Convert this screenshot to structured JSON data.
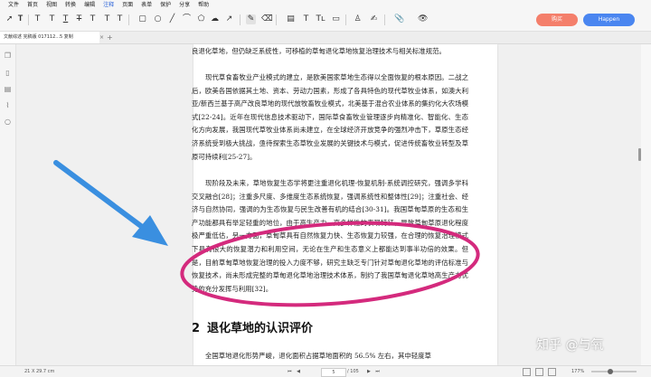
{
  "menu": [
    "文件",
    "首页",
    "视图",
    "转换",
    "编辑",
    "注释",
    "页面",
    "表单",
    "保护",
    "分享",
    "帮助"
  ],
  "active_menu": "注释",
  "toolbar_icons": [
    "select-arrow-icon",
    "text-edit-icon",
    "highlight-text-icon",
    "text-box-icon",
    "underline-text-icon",
    "strikethrough-text-icon",
    "rectangle-icon",
    "circle-icon",
    "line-icon",
    "polyline-icon",
    "polygon-icon",
    "arrow-icon",
    "pencil-icon",
    "eraser-icon",
    "callout-icon",
    "textbox-annotation-icon",
    "typewriter-icon",
    "note-icon",
    "stamp-icon",
    "signature-icon",
    "attachment-icon",
    "hide-annotations-icon"
  ],
  "buttons": {
    "pro": "购买",
    "user": "Happen"
  },
  "tab": {
    "title": "文献综述 完稿版 017112...5 复制",
    "close": "×",
    "add": "+"
  },
  "document": {
    "paragraphs": [
      "良退化草地，但仍缺乏系统性，可移植的草甸退化草地恢复治理技术与相关标准规范。",
      "现代草食畜牧业产业模式的建立，是欧美国家草地生态得以全面恢复的根本原因。二战之后，欧美各国依据其土地、资本、劳动力国素，形成了各具特色的现代草牧业体系，如澳大利亚/新西兰基于高产改良草地的现代放牧畜牧业模式，北美基于混合农业体系的集约化大农场模式[22-24]。近年在现代信息技术驱动下，国际草食畜牧业管理逐步向精准化、智能化、生态化方向发展，我国现代草牧业体系尚未建立，在全球经济开放竞争的强烈冲击下，草原生态经济系统受到极大挑战，亟待探索生态草牧业发展的关键技术与模式，促进传统畜牧业转型及草原可持续利[25-27]。",
      "现阶段及未来，草地恢复生态学将更注重退化机理-恢复机制-系统调控研究，强调多学科交叉融合[28]；注重多尺度、多维度生态系统恢复，强调系统性和整体性[29]；注重社会、经济与自然协同，强调的为生态恢复与民生改善有机的结合[30-31]。我国草甸草原的生态和生产功能都具有举足轻重的地位，由于高生产力、高多样性的表现特征，导致草甸草原退化程度极严重低估，另一方面，草甸草具有自然恢复力快、生态恢复力较强，在合理的恢复治理模式下具有很大的恢复潜力和利用空间，无论在生产和生态意义上都能达到事半功倍的效果。但是，目前草甸草地恢复治理的投入力度不够，研究主缺乏专门针对草甸退化草地的评估标准与恢复技术，尚未形成完整的草甸退化草地治理技术体系，制约了我国草甸退化草地高生产力优势的充分发挥与利用[32]。"
    ],
    "section_number": "2",
    "section_title": "退化草地的认识评价",
    "after_heading": "全国草地退化形势严峻，退化面积占据草地面积的 56.5% 左右，其中轻度草"
  },
  "status": {
    "page_size": "21 X 29.7 cm",
    "nav": "⏮ ◀",
    "nav_next": "▶ ⏭",
    "page": "5",
    "total": "/ 105",
    "zoom": "177%"
  },
  "watermark": "知乎 @与氧",
  "colors": {
    "pro": "#f47f6b",
    "user": "#4a86f0",
    "arrow": "#3a8fe0",
    "ellipse": "#d42a7d"
  }
}
